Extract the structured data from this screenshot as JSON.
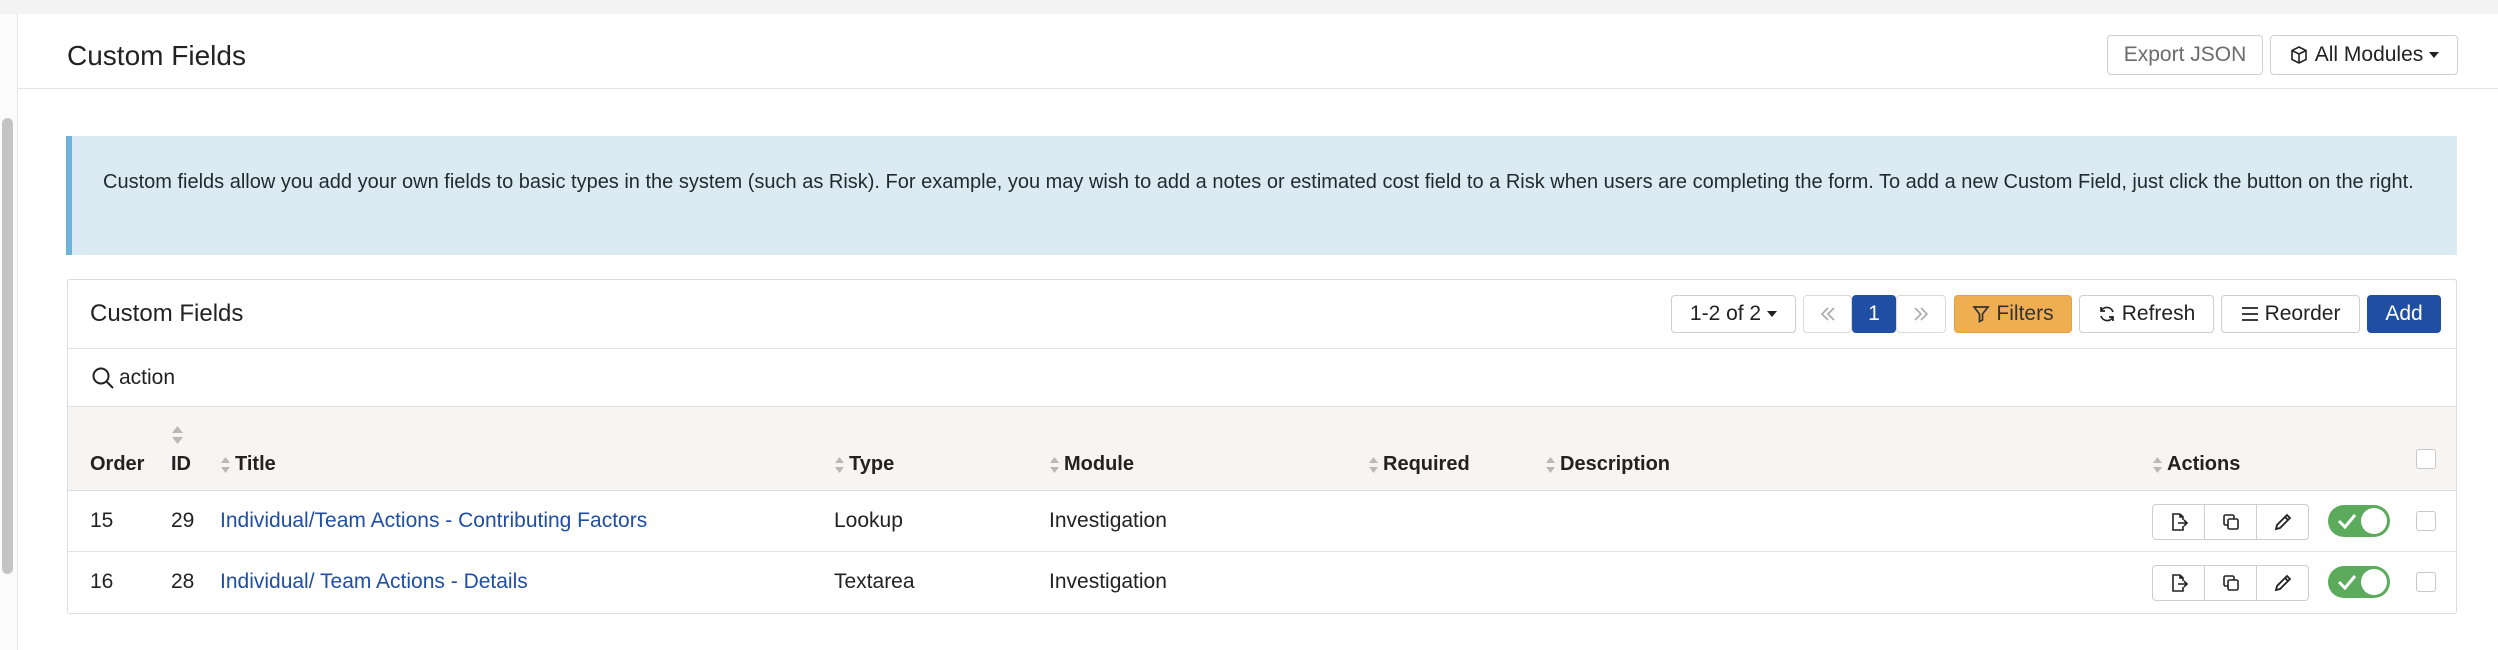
{
  "header": {
    "title": "Custom Fields",
    "export_label": "Export JSON",
    "modules_label": "All Modules"
  },
  "info": {
    "text": "Custom fields allow you add your own fields to basic types in the system (such as Risk). For example, you may wish to add a notes or estimated cost field to a Risk when users are completing the form. To add a new Custom Field, just click the button on the right."
  },
  "panel": {
    "title": "Custom Fields",
    "pager_count": "1-2 of 2",
    "page_current": "1",
    "filters_label": "Filters",
    "refresh_label": "Refresh",
    "reorder_label": "Reorder",
    "add_label": "Add"
  },
  "search": {
    "value": "action"
  },
  "table": {
    "columns": {
      "order": "Order",
      "id": "ID",
      "title": "Title",
      "type": "Type",
      "module": "Module",
      "required": "Required",
      "description": "Description",
      "actions": "Actions"
    },
    "rows": [
      {
        "order": "15",
        "id": "29",
        "title": "Individual/Team Actions - Contributing Factors",
        "type": "Lookup",
        "module": "Investigation",
        "required": "",
        "description": "",
        "enabled": true
      },
      {
        "order": "16",
        "id": "28",
        "title": "Individual/ Team Actions - Details",
        "type": "Textarea",
        "module": "Investigation",
        "required": "",
        "description": "",
        "enabled": true
      }
    ]
  },
  "colors": {
    "primary": "#1f4ea3",
    "filters": "#efae52",
    "toggle_on": "#5cab5c",
    "info_bg": "#dcebf3",
    "info_border": "#6cb3d7"
  }
}
